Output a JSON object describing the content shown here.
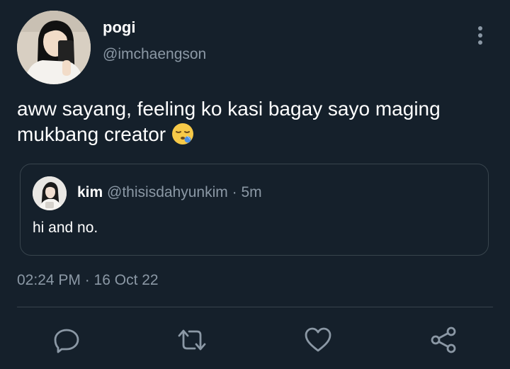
{
  "tweet": {
    "display_name": "pogi",
    "handle": "@imchaengson",
    "text": "aww sayang, feeling ko kasi bagay sayo maging mukbang creator",
    "timestamp": "02:24 PM · 16 Oct 22"
  },
  "quoted": {
    "display_name": "kim",
    "handle": "@thisisdahyunkim",
    "separator": "·",
    "time": "5m",
    "text": "hi and no."
  },
  "icons": {
    "more": "more-vertical-icon",
    "reply": "reply-icon",
    "retweet": "retweet-icon",
    "like": "heart-icon",
    "share": "share-icon",
    "emoji": "sleepy-face-emoji"
  },
  "colors": {
    "background": "#15202b",
    "secondary_text": "#8b98a5",
    "border": "#38444d"
  }
}
